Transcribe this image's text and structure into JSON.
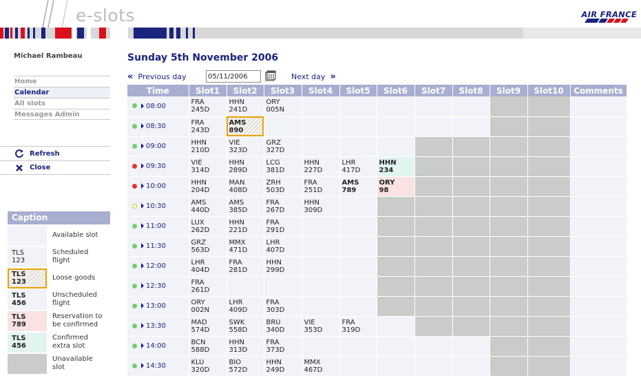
{
  "header": {
    "app_title": "e-slots",
    "brand": "AIR FRANCE"
  },
  "user": {
    "name": "Michael Rambeau"
  },
  "nav": [
    {
      "label": "Home",
      "active": false
    },
    {
      "label": "Calendar",
      "active": true
    },
    {
      "label": "All slots",
      "active": false
    },
    {
      "label": "Messages Admin",
      "active": false
    }
  ],
  "actions": {
    "refresh": "Refresh",
    "close": "Close"
  },
  "caption": {
    "title": "Caption",
    "items": [
      {
        "code": "",
        "num": "",
        "label_1": "Available slot",
        "label_2": "",
        "style": "avail"
      },
      {
        "code": "TLS",
        "num": "123",
        "label_1": "Scheduled",
        "label_2": "flight",
        "style": "sched"
      },
      {
        "code": "TLS",
        "num": "123",
        "label_1": "Loose goods",
        "label_2": "",
        "style": "loose"
      },
      {
        "code": "TLS",
        "num": "456",
        "label_1": "Unscheduled",
        "label_2": "flight",
        "style": "unsched"
      },
      {
        "code": "TLS",
        "num": "789",
        "label_1": "Reservation to",
        "label_2": "be confirmed",
        "style": "reserv"
      },
      {
        "code": "TLS",
        "num": "456",
        "label_1": "Confirmed",
        "label_2": "extra slot",
        "style": "confirmed"
      },
      {
        "code": "",
        "num": "",
        "label_1": "Unavailable",
        "label_2": "slot",
        "style": "unavail"
      }
    ]
  },
  "main": {
    "date_title": "Sunday 5th November 2006",
    "prev_label": "Previous day",
    "next_label": "Next day",
    "date_value": "05/11/2006"
  },
  "grid": {
    "columns": [
      "Time",
      "Slot1",
      "Slot2",
      "Slot3",
      "Slot4",
      "Slot5",
      "Slot6",
      "Slot7",
      "Slot8",
      "Slot9",
      "Slot10",
      "Comments"
    ],
    "rows": [
      {
        "time": "08:00",
        "status": "green",
        "slots": [
          {
            "a": "FRA",
            "b": "245D",
            "s": "sched"
          },
          {
            "a": "HHN",
            "b": "241D",
            "s": "sched"
          },
          {
            "a": "ORY",
            "b": "005N",
            "s": "sched"
          },
          {
            "s": "avail"
          },
          {
            "s": "avail"
          },
          {
            "s": "avail"
          },
          {
            "s": "avail"
          },
          {
            "s": "avail"
          },
          {
            "s": "unavail"
          },
          {
            "s": "unavail"
          }
        ]
      },
      {
        "time": "08:30",
        "status": "green",
        "slots": [
          {
            "a": "FRA",
            "b": "243D",
            "s": "sched"
          },
          {
            "a": "AMS",
            "b": "890",
            "s": "loose"
          },
          {
            "s": "avail"
          },
          {
            "s": "avail"
          },
          {
            "s": "avail"
          },
          {
            "s": "avail"
          },
          {
            "s": "avail"
          },
          {
            "s": "avail"
          },
          {
            "s": "unavail"
          },
          {
            "s": "unavail"
          }
        ]
      },
      {
        "time": "09:00",
        "status": "green",
        "slots": [
          {
            "a": "HHN",
            "b": "210D",
            "s": "sched"
          },
          {
            "a": "VIE",
            "b": "323D",
            "s": "sched"
          },
          {
            "a": "GRZ",
            "b": "327D",
            "s": "sched"
          },
          {
            "s": "avail"
          },
          {
            "s": "avail"
          },
          {
            "s": "avail"
          },
          {
            "s": "unavail"
          },
          {
            "s": "unavail"
          },
          {
            "s": "unavail"
          },
          {
            "s": "unavail"
          }
        ]
      },
      {
        "time": "09:30",
        "status": "red",
        "slots": [
          {
            "a": "VIE",
            "b": "314D",
            "s": "sched"
          },
          {
            "a": "HHN",
            "b": "289D",
            "s": "sched"
          },
          {
            "a": "LCG",
            "b": "381D",
            "s": "sched"
          },
          {
            "a": "HHN",
            "b": "227D",
            "s": "sched"
          },
          {
            "a": "LHR",
            "b": "417D",
            "s": "sched"
          },
          {
            "a": "HHN",
            "b": "234",
            "s": "confirmed"
          },
          {
            "s": "unavail"
          },
          {
            "s": "unavail"
          },
          {
            "s": "unavail"
          },
          {
            "s": "unavail"
          }
        ]
      },
      {
        "time": "10:00",
        "status": "red",
        "slots": [
          {
            "a": "HHN",
            "b": "204D",
            "s": "sched"
          },
          {
            "a": "MAN",
            "b": "408D",
            "s": "sched"
          },
          {
            "a": "ZRH",
            "b": "503D",
            "s": "sched"
          },
          {
            "a": "FRA",
            "b": "251D",
            "s": "sched"
          },
          {
            "a": "AMS",
            "b": "789",
            "s": "unsched"
          },
          {
            "a": "ORY",
            "b": "98",
            "s": "reserv"
          },
          {
            "s": "unavail"
          },
          {
            "s": "unavail"
          },
          {
            "s": "unavail"
          },
          {
            "s": "unavail"
          }
        ]
      },
      {
        "time": "10:30",
        "status": "yellow",
        "slots": [
          {
            "a": "AMS",
            "b": "440D",
            "s": "sched"
          },
          {
            "a": "AMS",
            "b": "385D",
            "s": "sched"
          },
          {
            "a": "FRA",
            "b": "267D",
            "s": "sched"
          },
          {
            "a": "HHN",
            "b": "309D",
            "s": "sched"
          },
          {
            "s": "avail"
          },
          {
            "s": "unavail"
          },
          {
            "s": "unavail"
          },
          {
            "s": "unavail"
          },
          {
            "s": "unavail"
          },
          {
            "s": "unavail"
          }
        ]
      },
      {
        "time": "11:00",
        "status": "green",
        "slots": [
          {
            "a": "LUX",
            "b": "262D",
            "s": "sched"
          },
          {
            "a": "HHN",
            "b": "221D",
            "s": "sched"
          },
          {
            "a": "FRA",
            "b": "291D",
            "s": "sched"
          },
          {
            "s": "avail"
          },
          {
            "s": "avail"
          },
          {
            "s": "unavail"
          },
          {
            "s": "unavail"
          },
          {
            "s": "unavail"
          },
          {
            "s": "unavail"
          },
          {
            "s": "unavail"
          }
        ]
      },
      {
        "time": "11:30",
        "status": "green",
        "slots": [
          {
            "a": "GRZ",
            "b": "563D",
            "s": "sched"
          },
          {
            "a": "MMX",
            "b": "471D",
            "s": "sched"
          },
          {
            "a": "LHR",
            "b": "407D",
            "s": "sched"
          },
          {
            "s": "avail"
          },
          {
            "s": "avail"
          },
          {
            "s": "unavail"
          },
          {
            "s": "unavail"
          },
          {
            "s": "unavail"
          },
          {
            "s": "unavail"
          },
          {
            "s": "unavail"
          }
        ]
      },
      {
        "time": "12:00",
        "status": "green",
        "slots": [
          {
            "a": "LHR",
            "b": "404D",
            "s": "sched"
          },
          {
            "a": "FRA",
            "b": "281D",
            "s": "sched"
          },
          {
            "a": "HHN",
            "b": "299D",
            "s": "sched"
          },
          {
            "s": "avail"
          },
          {
            "s": "avail"
          },
          {
            "s": "unavail"
          },
          {
            "s": "unavail"
          },
          {
            "s": "unavail"
          },
          {
            "s": "unavail"
          },
          {
            "s": "unavail"
          }
        ]
      },
      {
        "time": "12:30",
        "status": "green",
        "slots": [
          {
            "a": "FRA",
            "b": "261D",
            "s": "sched"
          },
          {
            "s": "avail"
          },
          {
            "s": "avail"
          },
          {
            "s": "avail"
          },
          {
            "s": "avail"
          },
          {
            "s": "unavail"
          },
          {
            "s": "unavail"
          },
          {
            "s": "unavail"
          },
          {
            "s": "unavail"
          },
          {
            "s": "unavail"
          }
        ]
      },
      {
        "time": "13:00",
        "status": "green",
        "slots": [
          {
            "a": "ORY",
            "b": "002N",
            "s": "sched"
          },
          {
            "a": "LHR",
            "b": "409D",
            "s": "sched"
          },
          {
            "a": "FRA",
            "b": "303D",
            "s": "sched"
          },
          {
            "s": "avail"
          },
          {
            "s": "avail"
          },
          {
            "s": "unavail"
          },
          {
            "s": "unavail"
          },
          {
            "s": "unavail"
          },
          {
            "s": "unavail"
          },
          {
            "s": "unavail"
          }
        ]
      },
      {
        "time": "13:30",
        "status": "green",
        "slots": [
          {
            "a": "MAD",
            "b": "574D",
            "s": "sched"
          },
          {
            "a": "SWK",
            "b": "558D",
            "s": "sched"
          },
          {
            "a": "BRU",
            "b": "340D",
            "s": "sched"
          },
          {
            "a": "VIE",
            "b": "353D",
            "s": "sched"
          },
          {
            "a": "FRA",
            "b": "319D",
            "s": "sched"
          },
          {
            "s": "avail"
          },
          {
            "s": "unavail"
          },
          {
            "s": "unavail"
          },
          {
            "s": "unavail"
          },
          {
            "s": "unavail"
          }
        ]
      },
      {
        "time": "14:00",
        "status": "green",
        "slots": [
          {
            "a": "BCN",
            "b": "588D",
            "s": "sched"
          },
          {
            "a": "HHN",
            "b": "313D",
            "s": "sched"
          },
          {
            "a": "FRA",
            "b": "373D",
            "s": "sched"
          },
          {
            "s": "avail"
          },
          {
            "s": "avail"
          },
          {
            "s": "avail"
          },
          {
            "s": "avail"
          },
          {
            "s": "avail"
          },
          {
            "s": "unavail"
          },
          {
            "s": "unavail"
          }
        ]
      },
      {
        "time": "14:30",
        "status": "green",
        "slots": [
          {
            "a": "KLU",
            "b": "320D",
            "s": "sched"
          },
          {
            "a": "BIO",
            "b": "572D",
            "s": "sched"
          },
          {
            "a": "HHN",
            "b": "249D",
            "s": "sched"
          },
          {
            "a": "MMX",
            "b": "467D",
            "s": "sched"
          },
          {
            "s": "avail"
          },
          {
            "s": "avail"
          },
          {
            "s": "avail"
          },
          {
            "s": "avail"
          },
          {
            "s": "unavail"
          },
          {
            "s": "unavail"
          }
        ]
      }
    ]
  }
}
